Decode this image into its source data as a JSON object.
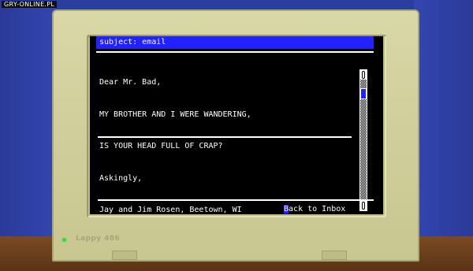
{
  "watermark": "GRY-ONLINE.PL",
  "email": {
    "subject": "subject: email",
    "lines": [
      "Dear Mr. Bad,",
      "MY BROTHER AND I WERE WANDERING,",
      "IS YOUR HEAD FULL OF CRAP?",
      "Askingly,",
      "Jay and Jim Rosen, Beetown, WI"
    ]
  },
  "back_button": {
    "highlight_letter": "B",
    "rest": "ack to Inbox"
  },
  "monitor": {
    "brand": "Lappy 486"
  },
  "colors": {
    "accent": "#2222ff",
    "screen": "#000000",
    "bezel": "#d9d8a6",
    "led": "#39d64a"
  },
  "scroll": {
    "position": 0.08
  }
}
